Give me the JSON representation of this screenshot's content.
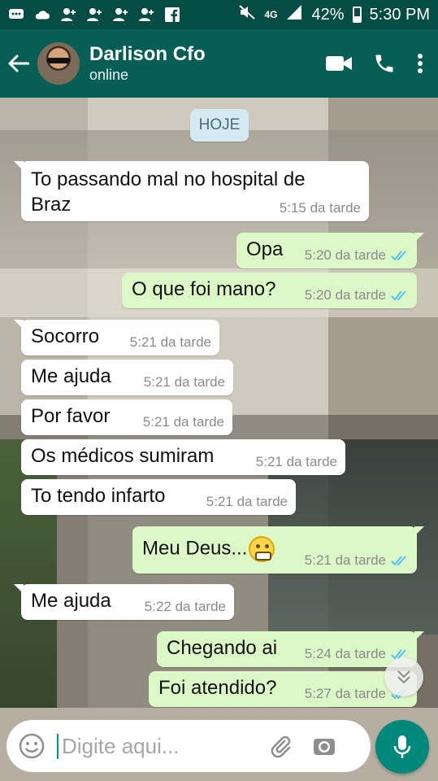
{
  "status_bar": {
    "network": "4G",
    "battery": "42%",
    "time": "5:30 PM"
  },
  "header": {
    "contact_name": "Darlison Cfo",
    "status": "online",
    "icons": [
      "back-arrow-icon",
      "video-call-icon",
      "phone-call-icon",
      "more-options-icon"
    ]
  },
  "chat": {
    "day_label": "HOJE",
    "messages": [
      {
        "dir": "in",
        "text": "To passando mal no hospital de Braz",
        "time": "5:15 da tarde"
      },
      {
        "dir": "out",
        "text": "Opa",
        "time": "5:20 da tarde",
        "read": true
      },
      {
        "dir": "out",
        "text": "O que foi mano?",
        "time": "5:20 da tarde",
        "read": true
      },
      {
        "dir": "in",
        "text": "Socorro",
        "time": "5:21 da tarde"
      },
      {
        "dir": "in",
        "text": "Me ajuda",
        "time": "5:21 da tarde"
      },
      {
        "dir": "in",
        "text": "Por favor",
        "time": "5:21 da tarde"
      },
      {
        "dir": "in",
        "text": "Os médicos sumiram",
        "time": "5:21 da tarde"
      },
      {
        "dir": "in",
        "text": "To tendo infarto",
        "time": "5:21 da tarde"
      },
      {
        "dir": "out",
        "text": "Meu Deus...",
        "emoji": "grimacing-face",
        "time": "5:21 da tarde",
        "read": true
      },
      {
        "dir": "in",
        "text": "Me ajuda",
        "time": "5:22 da tarde"
      },
      {
        "dir": "out",
        "text": "Chegando ai",
        "time": "5:24 da tarde",
        "read": true
      },
      {
        "dir": "out",
        "text": "Foi atendido?",
        "time": "5:27 da tarde",
        "read": true
      }
    ]
  },
  "input": {
    "placeholder": "Digite aqui...",
    "value": ""
  },
  "colors": {
    "header": "#075e54",
    "status_bar": "#054d44",
    "outgoing_bubble": "#dcf8c6",
    "incoming_bubble": "#ffffff",
    "read_ticks": "#4fc3f7",
    "mic_button": "#00897b"
  }
}
